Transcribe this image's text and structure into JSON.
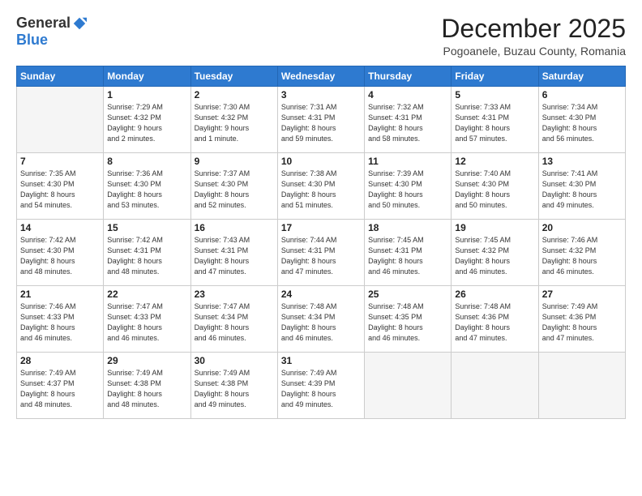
{
  "header": {
    "logo": {
      "general": "General",
      "blue": "Blue"
    },
    "title": "December 2025",
    "location": "Pogoanele, Buzau County, Romania"
  },
  "weekdays": [
    "Sunday",
    "Monday",
    "Tuesday",
    "Wednesday",
    "Thursday",
    "Friday",
    "Saturday"
  ],
  "weeks": [
    [
      {
        "day": "",
        "info": ""
      },
      {
        "day": "1",
        "info": "Sunrise: 7:29 AM\nSunset: 4:32 PM\nDaylight: 9 hours\nand 2 minutes."
      },
      {
        "day": "2",
        "info": "Sunrise: 7:30 AM\nSunset: 4:32 PM\nDaylight: 9 hours\nand 1 minute."
      },
      {
        "day": "3",
        "info": "Sunrise: 7:31 AM\nSunset: 4:31 PM\nDaylight: 8 hours\nand 59 minutes."
      },
      {
        "day": "4",
        "info": "Sunrise: 7:32 AM\nSunset: 4:31 PM\nDaylight: 8 hours\nand 58 minutes."
      },
      {
        "day": "5",
        "info": "Sunrise: 7:33 AM\nSunset: 4:31 PM\nDaylight: 8 hours\nand 57 minutes."
      },
      {
        "day": "6",
        "info": "Sunrise: 7:34 AM\nSunset: 4:30 PM\nDaylight: 8 hours\nand 56 minutes."
      }
    ],
    [
      {
        "day": "7",
        "info": "Sunrise: 7:35 AM\nSunset: 4:30 PM\nDaylight: 8 hours\nand 54 minutes."
      },
      {
        "day": "8",
        "info": "Sunrise: 7:36 AM\nSunset: 4:30 PM\nDaylight: 8 hours\nand 53 minutes."
      },
      {
        "day": "9",
        "info": "Sunrise: 7:37 AM\nSunset: 4:30 PM\nDaylight: 8 hours\nand 52 minutes."
      },
      {
        "day": "10",
        "info": "Sunrise: 7:38 AM\nSunset: 4:30 PM\nDaylight: 8 hours\nand 51 minutes."
      },
      {
        "day": "11",
        "info": "Sunrise: 7:39 AM\nSunset: 4:30 PM\nDaylight: 8 hours\nand 50 minutes."
      },
      {
        "day": "12",
        "info": "Sunrise: 7:40 AM\nSunset: 4:30 PM\nDaylight: 8 hours\nand 50 minutes."
      },
      {
        "day": "13",
        "info": "Sunrise: 7:41 AM\nSunset: 4:30 PM\nDaylight: 8 hours\nand 49 minutes."
      }
    ],
    [
      {
        "day": "14",
        "info": "Sunrise: 7:42 AM\nSunset: 4:30 PM\nDaylight: 8 hours\nand 48 minutes."
      },
      {
        "day": "15",
        "info": "Sunrise: 7:42 AM\nSunset: 4:31 PM\nDaylight: 8 hours\nand 48 minutes."
      },
      {
        "day": "16",
        "info": "Sunrise: 7:43 AM\nSunset: 4:31 PM\nDaylight: 8 hours\nand 47 minutes."
      },
      {
        "day": "17",
        "info": "Sunrise: 7:44 AM\nSunset: 4:31 PM\nDaylight: 8 hours\nand 47 minutes."
      },
      {
        "day": "18",
        "info": "Sunrise: 7:45 AM\nSunset: 4:31 PM\nDaylight: 8 hours\nand 46 minutes."
      },
      {
        "day": "19",
        "info": "Sunrise: 7:45 AM\nSunset: 4:32 PM\nDaylight: 8 hours\nand 46 minutes."
      },
      {
        "day": "20",
        "info": "Sunrise: 7:46 AM\nSunset: 4:32 PM\nDaylight: 8 hours\nand 46 minutes."
      }
    ],
    [
      {
        "day": "21",
        "info": "Sunrise: 7:46 AM\nSunset: 4:33 PM\nDaylight: 8 hours\nand 46 minutes."
      },
      {
        "day": "22",
        "info": "Sunrise: 7:47 AM\nSunset: 4:33 PM\nDaylight: 8 hours\nand 46 minutes."
      },
      {
        "day": "23",
        "info": "Sunrise: 7:47 AM\nSunset: 4:34 PM\nDaylight: 8 hours\nand 46 minutes."
      },
      {
        "day": "24",
        "info": "Sunrise: 7:48 AM\nSunset: 4:34 PM\nDaylight: 8 hours\nand 46 minutes."
      },
      {
        "day": "25",
        "info": "Sunrise: 7:48 AM\nSunset: 4:35 PM\nDaylight: 8 hours\nand 46 minutes."
      },
      {
        "day": "26",
        "info": "Sunrise: 7:48 AM\nSunset: 4:36 PM\nDaylight: 8 hours\nand 47 minutes."
      },
      {
        "day": "27",
        "info": "Sunrise: 7:49 AM\nSunset: 4:36 PM\nDaylight: 8 hours\nand 47 minutes."
      }
    ],
    [
      {
        "day": "28",
        "info": "Sunrise: 7:49 AM\nSunset: 4:37 PM\nDaylight: 8 hours\nand 48 minutes."
      },
      {
        "day": "29",
        "info": "Sunrise: 7:49 AM\nSunset: 4:38 PM\nDaylight: 8 hours\nand 48 minutes."
      },
      {
        "day": "30",
        "info": "Sunrise: 7:49 AM\nSunset: 4:38 PM\nDaylight: 8 hours\nand 49 minutes."
      },
      {
        "day": "31",
        "info": "Sunrise: 7:49 AM\nSunset: 4:39 PM\nDaylight: 8 hours\nand 49 minutes."
      },
      {
        "day": "",
        "info": ""
      },
      {
        "day": "",
        "info": ""
      },
      {
        "day": "",
        "info": ""
      }
    ]
  ]
}
